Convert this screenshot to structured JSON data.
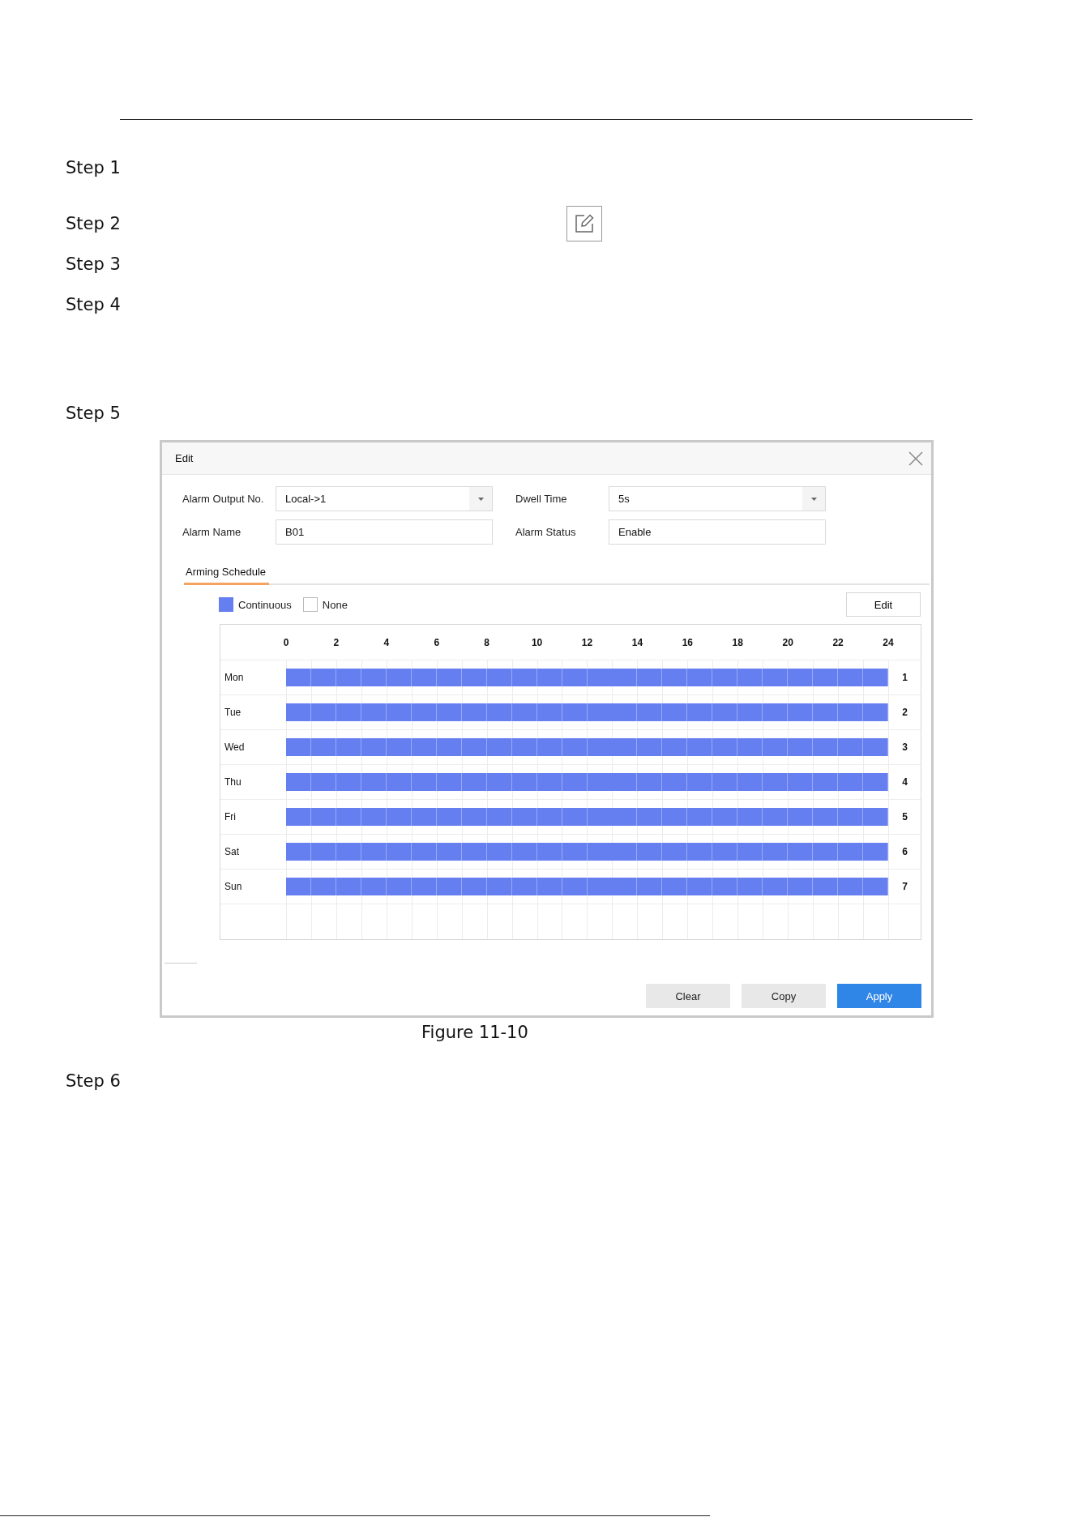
{
  "steps": [
    {
      "label": "Step 1"
    },
    {
      "label": "Step 2",
      "icon": true
    },
    {
      "label": "Step 3"
    },
    {
      "label": "Step 4"
    },
    {
      "label": "Step 5"
    }
  ],
  "dialog": {
    "title": "Edit",
    "fields": [
      {
        "label": "Alarm Output No.",
        "value": "Local->1",
        "kind": "dropdown"
      },
      {
        "label": "Dwell Time",
        "value": "5s",
        "kind": "dropdown"
      },
      {
        "label": "Alarm Name",
        "value": "B01",
        "kind": "text"
      },
      {
        "label": "Alarm Status",
        "value": "Enable",
        "kind": "text"
      }
    ],
    "tabs": [
      {
        "label": "Arming Schedule",
        "selected": true
      }
    ],
    "legend": [
      {
        "label": "Continuous",
        "color": "#657ff0"
      },
      {
        "label": "None",
        "color": "#ffffff"
      }
    ],
    "edit_button": "Edit",
    "hours": [
      "0",
      "2",
      "4",
      "6",
      "8",
      "10",
      "12",
      "14",
      "16",
      "18",
      "20",
      "22",
      "24"
    ],
    "days": [
      {
        "day": "Mon",
        "number": "1",
        "scheduled": true
      },
      {
        "day": "Tue",
        "number": "2",
        "scheduled": true
      },
      {
        "day": "Wed",
        "number": "3",
        "scheduled": true
      },
      {
        "day": "Thu",
        "number": "4",
        "scheduled": true
      },
      {
        "day": "Fri",
        "number": "5",
        "scheduled": true
      },
      {
        "day": "Sat",
        "number": "6",
        "scheduled": true
      },
      {
        "day": "Sun",
        "number": "7",
        "scheduled": true
      }
    ],
    "buttons": [
      {
        "label": "Clear",
        "kind": "secondary"
      },
      {
        "label": "Copy",
        "kind": "secondary"
      },
      {
        "label": "Apply",
        "kind": "primary"
      }
    ]
  },
  "caption": "Figure 11-10",
  "after_steps": [
    {
      "label": "Step 6"
    }
  ]
}
